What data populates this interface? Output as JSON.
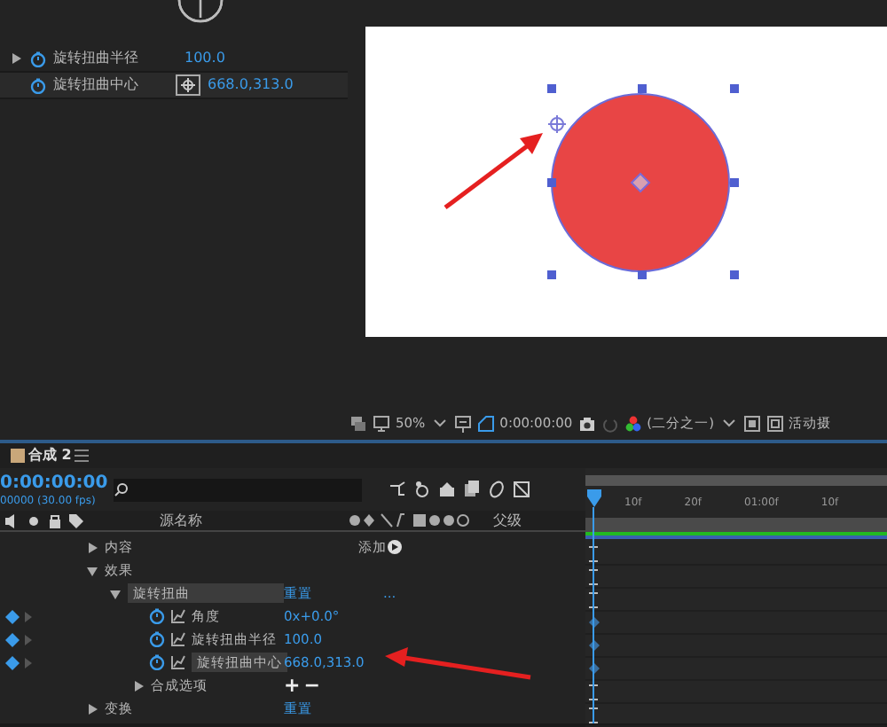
{
  "effect_controls": {
    "rows": [
      {
        "kind": "expandable",
        "label": "旋转扭曲半径",
        "value": "100.0",
        "expanded": false
      },
      {
        "kind": "point",
        "label": "旋转扭曲中心",
        "value": "668.0,313.0"
      }
    ]
  },
  "viewer": {
    "toolbar": {
      "zoom": "50%",
      "timecode": "0:00:00:00",
      "resolution": "(二分之一)",
      "camera": "活动摄"
    }
  },
  "timeline": {
    "tab": "合成 2",
    "timecode": "0:00:00:00",
    "frames": "00000 (30.00 fps)",
    "columns": {
      "name": "源名称",
      "parent": "父级"
    },
    "ruler": [
      "10f",
      "20f",
      "01:00f",
      "10f"
    ],
    "rows": [
      {
        "kind": "group",
        "label": "内容",
        "expanded": false,
        "value": "添加",
        "selected": false
      },
      {
        "kind": "group",
        "label": "效果",
        "expanded": true,
        "selected": false,
        "children": [
          {
            "kind": "group",
            "label": "旋转扭曲",
            "expanded": true,
            "value": "重置",
            "extra": "...",
            "selected": true,
            "children": [
              {
                "kind": "property",
                "label": "角度",
                "value": "0x+0.0°",
                "selected": false
              },
              {
                "kind": "property",
                "label": "旋转扭曲半径",
                "value": "100.0",
                "selected": false
              },
              {
                "kind": "property",
                "label": "旋转扭曲中心",
                "value": "668.0,313.0",
                "selected": true
              },
              {
                "kind": "group",
                "label": "合成选项",
                "expanded": false,
                "buttons": [
                  "+",
                  "−"
                ],
                "selected": false
              }
            ]
          }
        ]
      },
      {
        "kind": "group",
        "label": "变换",
        "expanded": false,
        "value": "重置",
        "selected": false
      }
    ]
  }
}
